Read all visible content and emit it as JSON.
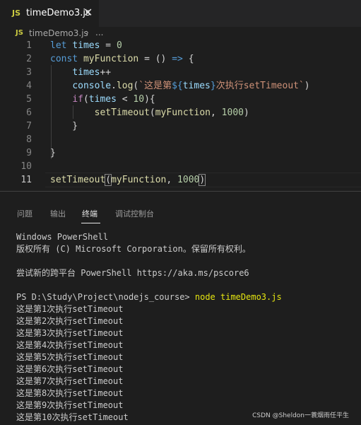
{
  "tab": {
    "badge": "JS",
    "title": "timeDemo3.js",
    "close_glyph": "✕"
  },
  "breadcrumb": {
    "badge": "JS",
    "file": "timeDemo3.js",
    "separator": "›",
    "more": "..."
  },
  "editor": {
    "line_numbers": [
      "1",
      "2",
      "3",
      "4",
      "5",
      "6",
      "7",
      "8",
      "9",
      "10",
      "11"
    ],
    "active_line": "11",
    "lines": [
      [
        [
          "let",
          "kw"
        ],
        [
          " ",
          "pun"
        ],
        [
          "times",
          "var"
        ],
        [
          " = ",
          "pun"
        ],
        [
          "0",
          "num"
        ]
      ],
      [
        [
          "const",
          "kw"
        ],
        [
          " ",
          "pun"
        ],
        [
          "myFunction",
          "fn"
        ],
        [
          " = () ",
          "pun"
        ],
        [
          "=>",
          "kw"
        ],
        [
          " {",
          "pun"
        ]
      ],
      [
        [
          "    ",
          "pun"
        ],
        [
          "times",
          "var"
        ],
        [
          "++",
          "pun"
        ]
      ],
      [
        [
          "    ",
          "pun"
        ],
        [
          "console",
          "var"
        ],
        [
          ".",
          "pun"
        ],
        [
          "log",
          "fn"
        ],
        [
          "(",
          "pun"
        ],
        [
          "`这是第",
          "str"
        ],
        [
          "${",
          "tmpl"
        ],
        [
          "times",
          "var"
        ],
        [
          "}",
          "tmpl"
        ],
        [
          "次执行setTimeout`",
          "str"
        ],
        [
          ")",
          "pun"
        ]
      ],
      [
        [
          "    ",
          "pun"
        ],
        [
          "if",
          "ctrl"
        ],
        [
          "(",
          "pun"
        ],
        [
          "times",
          "var"
        ],
        [
          " < ",
          "pun"
        ],
        [
          "10",
          "num"
        ],
        [
          "){",
          "pun"
        ]
      ],
      [
        [
          "        ",
          "pun"
        ],
        [
          "setTimeout",
          "fn"
        ],
        [
          "(",
          "pun"
        ],
        [
          "myFunction",
          "fn"
        ],
        [
          ", ",
          "pun"
        ],
        [
          "1000",
          "num"
        ],
        [
          ")",
          "pun"
        ]
      ],
      [
        [
          "    }",
          "pun"
        ]
      ],
      [],
      [
        [
          "}",
          "pun"
        ]
      ],
      [],
      [
        [
          "setTimeout",
          "fn"
        ],
        [
          "(",
          "bm"
        ],
        [
          "myFunction",
          "fn"
        ],
        [
          ", ",
          "pun"
        ],
        [
          "1000",
          "num"
        ],
        [
          ")",
          "bm"
        ]
      ]
    ]
  },
  "panel": {
    "tabs": [
      "问题",
      "输出",
      "终端",
      "调试控制台"
    ],
    "active_tab": "终端"
  },
  "terminal": {
    "lines": [
      "Windows PowerShell",
      "版权所有 (C) Microsoft Corporation。保留所有权利。",
      "",
      "尝试新的跨平台 PowerShell https://aka.ms/pscore6",
      "",
      "PS D:\\Study\\Project\\nodejs_course> ",
      "这是第1次执行setTimeout",
      "这是第2次执行setTimeout",
      "这是第3次执行setTimeout",
      "这是第4次执行setTimeout",
      "这是第5次执行setTimeout",
      "这是第6次执行setTimeout",
      "这是第7次执行setTimeout",
      "这是第8次执行setTimeout",
      "这是第9次执行setTimeout",
      "这是第10次执行setTimeout"
    ],
    "command": "node timeDemo3.js"
  },
  "watermark": "CSDN @Sheldon一蓑烟雨任平生"
}
